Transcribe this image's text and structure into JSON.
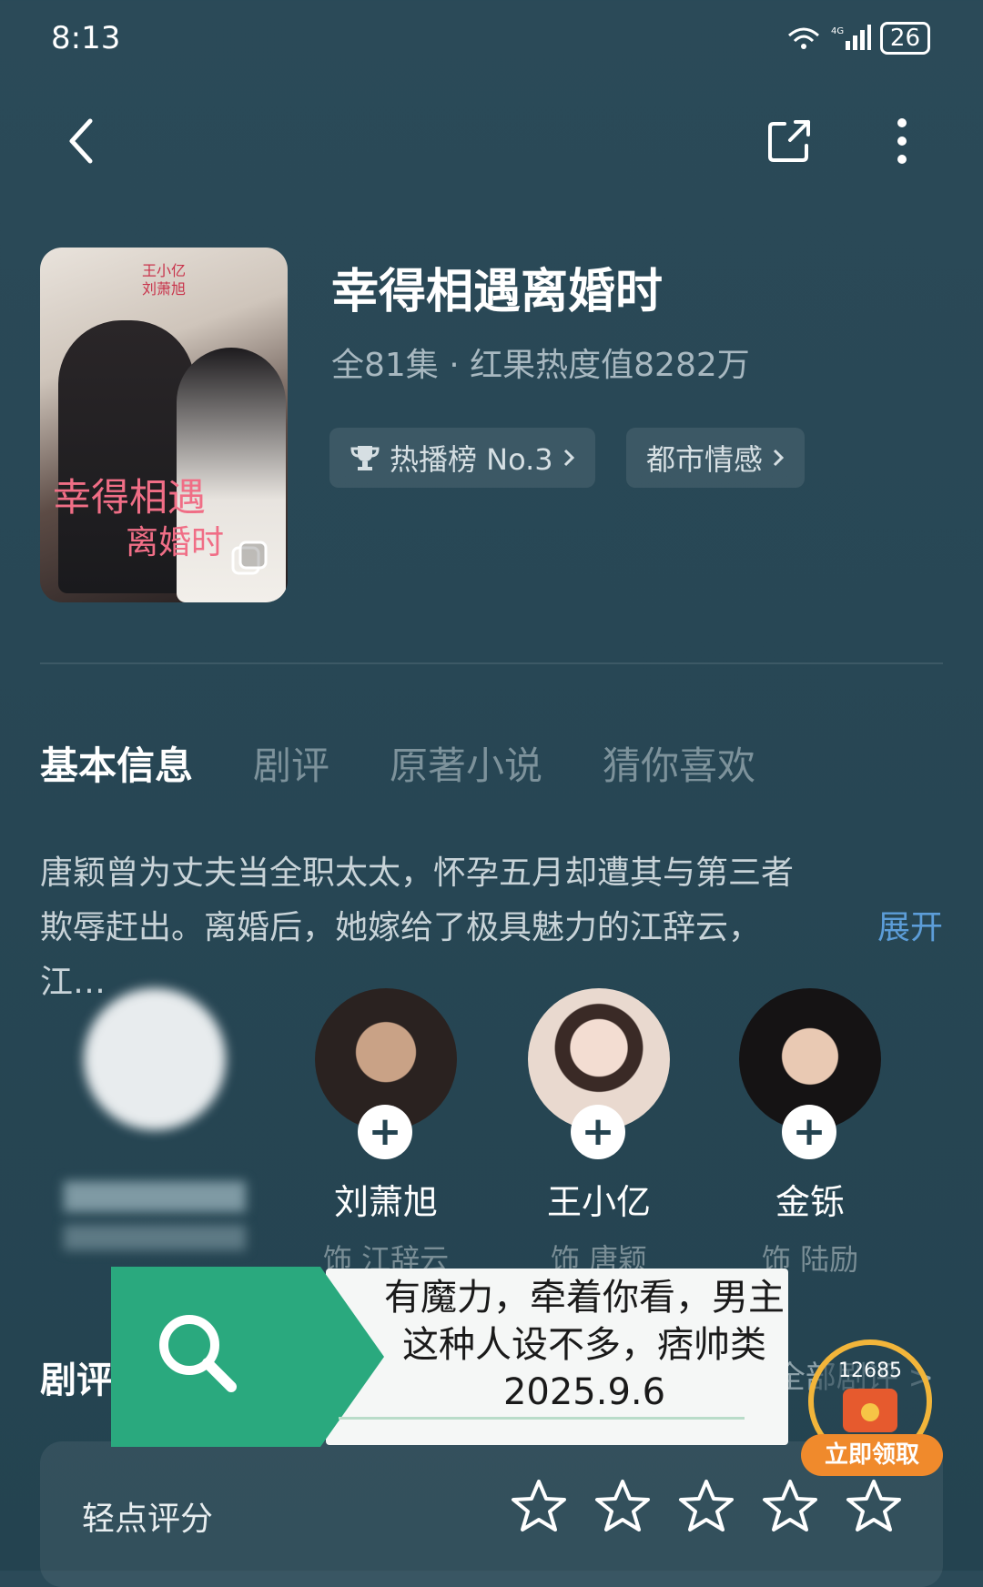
{
  "status_bar": {
    "time": "8:13",
    "signal": "4G",
    "wifi": "6",
    "battery": "26"
  },
  "show": {
    "title": "幸得相遇离婚时",
    "meta": "全81集 · 红果热度值8282万",
    "chips": [
      {
        "label": "热播榜 No.3",
        "icon": "trophy-icon"
      },
      {
        "label": "都市情感"
      }
    ],
    "poster": {
      "cast_line1": "王小亿",
      "cast_line2": "刘萧旭",
      "logo_line1": "幸得相遇",
      "logo_line2": "离婚时"
    }
  },
  "tabs": [
    {
      "label": "基本信息",
      "active": true
    },
    {
      "label": "剧评",
      "active": false
    },
    {
      "label": "原著小说",
      "active": false
    },
    {
      "label": "猜你喜欢",
      "active": false
    }
  ],
  "synopsis": {
    "text": "唐颖曾为丈夫当全职太太，怀孕五月却遭其与第三者欺辱赶出。离婚后，她嫁给了极具魅力的江辞云，江…",
    "expand_label": "展开"
  },
  "cast": [
    {
      "name": "",
      "role": "",
      "blurred": true
    },
    {
      "name": "刘萧旭",
      "role": "饰 江辞云"
    },
    {
      "name": "王小亿",
      "role": "饰 唐颖"
    },
    {
      "name": "金铄",
      "role": "饰 陆励"
    }
  ],
  "review_section": {
    "title": "剧评",
    "all_label": "全部剧评 >",
    "rating_label": "轻点评分",
    "stars": 5
  },
  "search_popup": {
    "text": "有魔力，牵着你看，男主这种人设不多，痞帅类2025.9.6"
  },
  "red_packet": {
    "count": "12685",
    "claim_label": "立即领取"
  },
  "colors": {
    "accent_link": "#5c9dd8",
    "popup_green": "#2aa97e",
    "packet_orange": "#f08a2c"
  }
}
